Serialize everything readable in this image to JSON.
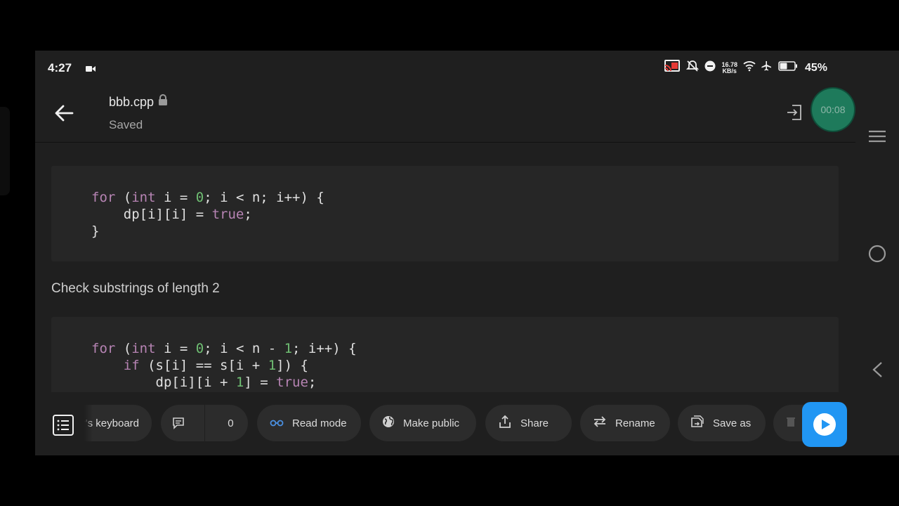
{
  "status": {
    "time": "4:27",
    "speed_value": "16.78",
    "speed_unit": "KB/s",
    "battery": "45%"
  },
  "header": {
    "title": "bbb.cpp",
    "subtitle": "Saved",
    "timer": "00:08"
  },
  "caption": "Check substrings of length 2",
  "toolbar": {
    "keyboard": "r's keyboard",
    "comment_count": "0",
    "read_mode": "Read mode",
    "make_public": "Make public",
    "share": "Share",
    "rename": "Rename",
    "save_as": "Save as"
  },
  "colors": {
    "keyword": "#b784b4",
    "number": "#6fbf73",
    "accent": "#2196f3",
    "recording": "#1e7a5b"
  }
}
